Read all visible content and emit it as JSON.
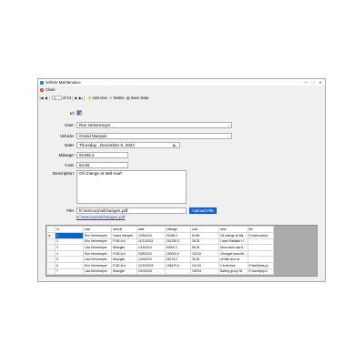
{
  "window": {
    "title": "Vehicle Maintenance"
  },
  "menu": {
    "close_label": "Close"
  },
  "navigator": {
    "position": "1",
    "of_label": "of 14",
    "add_label": "Add new",
    "delete_label": "Delete",
    "save_label": "Save Data"
  },
  "form": {
    "id_label": "Id:",
    "id_value": "1",
    "user_label": "User:",
    "user_value": "Ron Heinemeyer",
    "vehicle_label": "Vehicle:",
    "vehicle_value": "Grand Marquis",
    "date_label": "Date:",
    "date_value": "Thursday , December  5, 2024",
    "mileage_label": "Mileage:",
    "mileage_value": "91465.2",
    "cost_label": "Cost:",
    "cost_value": "54.65",
    "description_label": "Description:",
    "description_value": "Oil change at Wal-mart",
    "file_label": "File:",
    "file_value": "E:\\mercury\\oilchange1.pdf",
    "upload_label": "Upload File",
    "file_link": "E:\\mercury\\oilchange1.pdf"
  },
  "grid": {
    "columns": [
      "id",
      "user",
      "vehicle",
      "date",
      "mileage",
      "cost",
      "desc",
      "file"
    ],
    "rows": [
      [
        "1",
        "Ron Heinemeyer",
        "Grand Marquis",
        "12/5/2024",
        "91465.2",
        "54.65",
        "Oil change at Wa...",
        "E:\\mercury\\oil"
      ],
      [
        "2",
        "Ron Heinemeyer",
        "F150 4x4",
        "11/21/2024",
        "201296.3",
        "38.25",
        "Lower Radiator H...",
        ""
      ],
      [
        "3",
        "Lisa Heinemeyer",
        "Wrangler",
        "1/15/2024",
        "63000.2",
        "58.26",
        "New rotors and b...",
        ""
      ],
      [
        "4",
        "Ron Heinemeyer",
        "F150 4x4",
        "5/25/2024",
        "200000.5",
        "130.00",
        "Changed trans filt...",
        ""
      ],
      [
        "5",
        "Lisa Heinemeyer",
        "Wrangler",
        "10/3/2023",
        "65276.2",
        "30.00",
        "oil filter and oil",
        ""
      ],
      [
        "6",
        "Ron Heinemeyer",
        "F150 4x4",
        "12/10/2023",
        "196679.3",
        "210.00",
        "2 front tires",
        "E:\\ford\\tires.pc"
      ],
      [
        "7",
        "Lisa Heinemeyer",
        "Wrangler",
        "2/10/2025",
        "",
        "169.54",
        "Battery group 34",
        "E:\\camrlpep.b"
      ]
    ]
  }
}
